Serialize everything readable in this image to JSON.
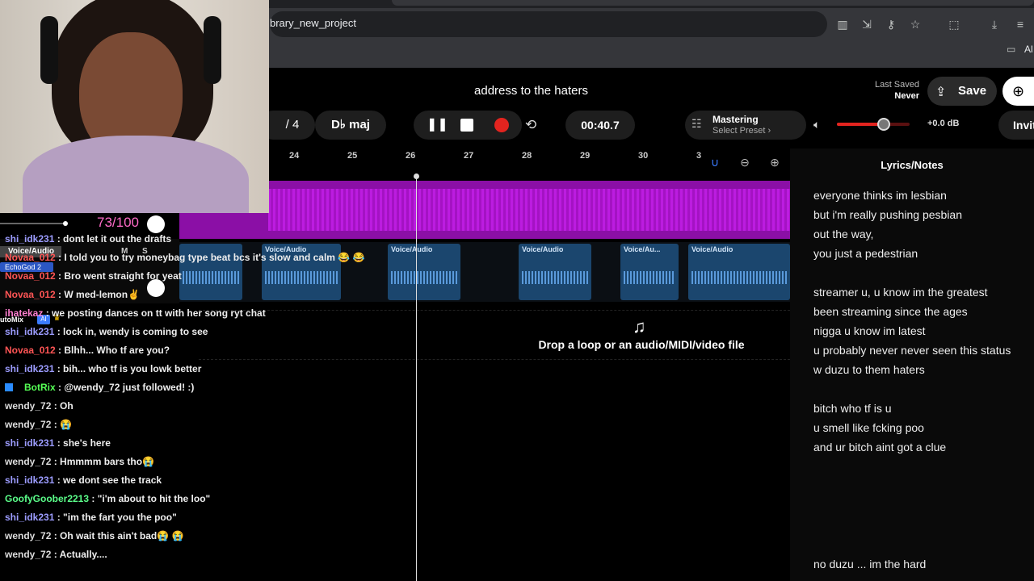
{
  "browser": {
    "url": "brary_new_project",
    "bookmarks_label": "Al"
  },
  "header": {
    "title": "address to the haters",
    "last_saved_label": "Last Saved",
    "last_saved_value": "Never",
    "save_label": "Save",
    "invite_label": "Invit"
  },
  "toolbar": {
    "time_signature": "/ 4",
    "key": "D♭ maj",
    "time": "00:40.7",
    "mastering_title": "Mastering",
    "mastering_preset": "Select Preset",
    "volume_db": "+0.0 dB",
    "volume_level": 0.65
  },
  "ruler": [
    "24",
    "25",
    "26",
    "27",
    "28",
    "29",
    "30",
    "3"
  ],
  "clips": [
    "Voice/Audio",
    "Voice/Audio",
    "Voice/Au...",
    "Voice/Audio",
    "Voice/Audio"
  ],
  "dropzone": {
    "text": "Drop a loop or an audio/MIDI/video file"
  },
  "lyrics": {
    "title": "Lyrics/Notes",
    "lines": [
      "everyone thinks im lesbian",
      "but i'm really pushing pesbian",
      "out the way,",
      "you just a pedestrian",
      "",
      "streamer u, u know im the greatest",
      "been streaming since the ages",
      "nigga u know im latest",
      "u probably never never seen this status",
      "w duzu to them haters",
      "",
      "bitch who tf is u",
      "u smell like fcking poo",
      "and ur bitch aint got a clue"
    ],
    "last_line": "no duzu ... im the hard"
  },
  "overlay": {
    "counter": "73/100",
    "channel_label": "Voice/Audio",
    "echo_label": "EchoGod 2",
    "automix_label": "utoMix",
    "ai_label": "AI"
  },
  "chat": [
    {
      "user": "shi_idk231",
      "msg": ": dont let it out the drafts",
      "color": "#9c9cff"
    },
    {
      "user": "Novaa_012",
      "msg": ": I told you to try moneybag type beat bcs it's slow and calm 😂 😂",
      "color": "#ff5555"
    },
    {
      "user": "Novaa_012",
      "msg": ": Bro went straight for yeat",
      "color": "#ff5555"
    },
    {
      "user": "Novaa_012",
      "msg": ": W med-lemon✌",
      "color": "#ff5555"
    },
    {
      "user": "ihatekaz",
      "msg": ": we posting dances on tt with her song ryt chat",
      "color": "#ff7fd0"
    },
    {
      "user": "shi_idk231",
      "msg": ": lock in, wendy is coming to see",
      "color": "#9c9cff"
    },
    {
      "user": "Novaa_012",
      "msg": ": Blhh... Who tf are you?",
      "color": "#ff5555"
    },
    {
      "user": "shi_idk231",
      "msg": ": bih... who tf is you lowk better",
      "color": "#9c9cff"
    },
    {
      "user": "BotRix",
      "msg": ": @wendy_72 just followed! :)",
      "color": "#55ff55"
    },
    {
      "user": "wendy_72",
      "msg": ": Oh",
      "color": "#dddddd"
    },
    {
      "user": "wendy_72",
      "msg": ": 😭",
      "color": "#dddddd"
    },
    {
      "user": "shi_idk231",
      "msg": ": she's here",
      "color": "#9c9cff"
    },
    {
      "user": "wendy_72",
      "msg": ": Hmmmm bars tho😭",
      "color": "#dddddd"
    },
    {
      "user": "shi_idk231",
      "msg": ": we dont see the track",
      "color": "#9c9cff"
    },
    {
      "user": "GoofyGoober2213",
      "msg": ": \"i'm about to hit the loo\"",
      "color": "#5bff8a"
    },
    {
      "user": "shi_idk231",
      "msg": ": \"im the fart you the poo\"",
      "color": "#9c9cff"
    },
    {
      "user": "wendy_72",
      "msg": ": Oh wait this ain't bad😭 😭",
      "color": "#dddddd"
    },
    {
      "user": "wendy_72",
      "msg": ": Actually....",
      "color": "#dddddd"
    }
  ]
}
